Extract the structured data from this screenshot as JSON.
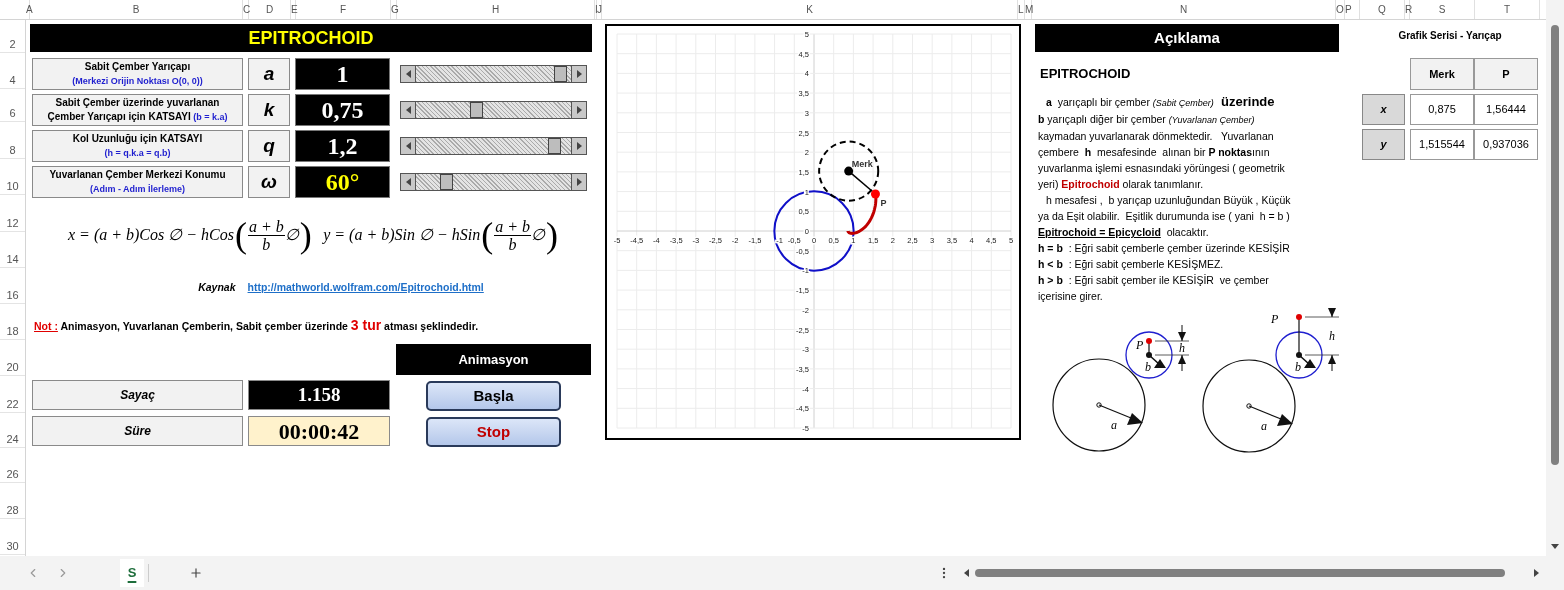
{
  "columns": [
    "A",
    "B",
    "C",
    "D",
    "E",
    "F",
    "G",
    "H",
    "I",
    "J",
    "K",
    "L",
    "M",
    "N",
    "O",
    "P",
    "Q",
    "R",
    "S",
    "T"
  ],
  "rows": [
    "2",
    "4",
    "6",
    "8",
    "10",
    "12",
    "14",
    "16",
    "18",
    "20",
    "22",
    "24",
    "26",
    "28",
    "30"
  ],
  "title": "EPITROCHOID",
  "parameters": [
    {
      "label": [
        "Sabit Çember Yarıçapı"
      ],
      "note": "(Merkezi Orijin Noktası O(0, 0))",
      "note_inline": false,
      "symbol": "a",
      "value": "1",
      "highlight": false,
      "level": 0.97
    },
    {
      "label": [
        "Sabit Çember üzerinde yuvarlanan",
        "Çember Yarıçapı için KATSAYI"
      ],
      "note": "(b = k.a)",
      "note_inline": true,
      "symbol": "k",
      "value": "0,75",
      "highlight": false,
      "level": 0.38
    },
    {
      "label": [
        "Kol Uzunluğu için KATSAYI"
      ],
      "note": "(h = q.k.a = q.b)",
      "note_inline": false,
      "symbol": "q",
      "value": "1,2",
      "highlight": false,
      "level": 0.93
    },
    {
      "label": [
        "Yuvarlanan Çember Merkezi Konumu"
      ],
      "note": "(Adım - Adım İlerleme)",
      "note_inline": false,
      "symbol": "ω",
      "value": "60°",
      "highlight": true,
      "level": 0.17
    }
  ],
  "formulas": [
    {
      "lhs": "x = (a + b)Cos ∅ − hCos",
      "open": "(",
      "num": "a + b",
      "den": "b",
      "tail": "∅",
      "close": ")"
    },
    {
      "lhs": "y = (a + b)Sin ∅ − hSin",
      "open": "(",
      "num": "a + b",
      "den": "b",
      "tail": "∅",
      "close": ")"
    }
  ],
  "source": {
    "label": "Kaynak",
    "url": "http://mathworld.wolfram.com/Epitrochoid.html"
  },
  "note": {
    "label": "Not :",
    "parts": [
      {
        "text": "Animasyon, Yuvarlanan Çemberin, Sabit çember üzerinde ",
        "kind": "plain"
      },
      {
        "text": "3 tur",
        "kind": "highlight"
      },
      {
        "text": " atması şeklindedir.",
        "kind": "plain"
      }
    ]
  },
  "counters": [
    {
      "label": "Sayaç",
      "value": "1.158",
      "kind": "dark"
    },
    {
      "label": "Süre",
      "value": "00:00:42",
      "kind": "light"
    }
  ],
  "animation": {
    "title": "Animasyon",
    "buttons": [
      {
        "label": "Başla",
        "kind": "start"
      },
      {
        "label": "Stop",
        "kind": "stop"
      }
    ]
  },
  "chart": {
    "chart_data": {
      "type": "scatter",
      "grid": true,
      "xlim": [
        -5,
        5
      ],
      "ylim": [
        -5,
        5
      ],
      "xticks": [
        {
          "value": -5,
          "label": "-5"
        },
        {
          "value": -4.5,
          "label": "-4,5"
        },
        {
          "value": -4,
          "label": "-4"
        },
        {
          "value": -3.5,
          "label": "-3,5"
        },
        {
          "value": -3,
          "label": "-3"
        },
        {
          "value": -2.5,
          "label": "-2,5"
        },
        {
          "value": -2,
          "label": "-2"
        },
        {
          "value": -1.5,
          "label": "-1,5"
        },
        {
          "value": -1,
          "label": "-1"
        },
        {
          "value": -0.5,
          "label": "-0,5"
        },
        {
          "value": 0,
          "label": "0"
        },
        {
          "value": 0.5,
          "label": "0,5"
        },
        {
          "value": 1,
          "label": "1"
        },
        {
          "value": 1.5,
          "label": "1,5"
        },
        {
          "value": 2,
          "label": "2"
        },
        {
          "value": 2.5,
          "label": "2,5"
        },
        {
          "value": 3,
          "label": "3"
        },
        {
          "value": 3.5,
          "label": "3,5"
        },
        {
          "value": 4,
          "label": "4"
        },
        {
          "value": 4.5,
          "label": "4,5"
        },
        {
          "value": 5,
          "label": "5"
        }
      ],
      "yticks": [
        {
          "value": -5,
          "label": "-5"
        },
        {
          "value": -4.5,
          "label": "-4,5"
        },
        {
          "value": -4,
          "label": "-4"
        },
        {
          "value": -3.5,
          "label": "-3,5"
        },
        {
          "value": -3,
          "label": "-3"
        },
        {
          "value": -2.5,
          "label": "-2,5"
        },
        {
          "value": -2,
          "label": "-2"
        },
        {
          "value": -1.5,
          "label": "-1,5"
        },
        {
          "value": -1,
          "label": "-1"
        },
        {
          "value": -0.5,
          "label": "-0,5"
        },
        {
          "value": 0,
          "label": "0"
        },
        {
          "value": 0.5,
          "label": "0,5"
        },
        {
          "value": 1,
          "label": "1"
        },
        {
          "value": 1.5,
          "label": "1,5"
        },
        {
          "value": 2,
          "label": "2"
        },
        {
          "value": 2.5,
          "label": "2,5"
        },
        {
          "value": 3,
          "label": "3"
        },
        {
          "value": 3.5,
          "label": "3,5"
        },
        {
          "value": 4,
          "label": "4"
        },
        {
          "value": 4.5,
          "label": "4,5"
        },
        {
          "value": 5,
          "label": "5"
        }
      ],
      "series": [
        {
          "name": "Merk",
          "color": "#000000",
          "x": [
            0.88
          ],
          "values": [
            1.52
          ]
        },
        {
          "name": "P",
          "color": "#ff0000",
          "x": [
            1.56
          ],
          "values": [
            0.94
          ]
        }
      ]
    }
  },
  "description": {
    "title": "Açıklama",
    "heading": "EPITROCHOID",
    "paragraphs": [
      {
        "indent": true,
        "lines": [
          [
            {
              "text": "a",
              "kind": "bold"
            },
            {
              "text": "  yarıçaplı bir çember ",
              "kind": "plain"
            },
            {
              "text": "(Sabit Çember)",
              "kind": "aside"
            },
            {
              "text": "  üzerinde",
              "kind": "emphasis"
            }
          ],
          [
            {
              "text": "b",
              "kind": "bold"
            },
            {
              "text": " yarıçaplı diğer bir çember ",
              "kind": "plain"
            },
            {
              "text": "(Yuvarlanan Çember)",
              "kind": "aside"
            }
          ],
          [
            {
              "text": "kaymadan yuvarlanarak dönmektedir.   Yuvarlanan",
              "kind": "plain"
            }
          ],
          [
            {
              "text": "çembere  ",
              "kind": "plain"
            },
            {
              "text": "h",
              "kind": "bold"
            },
            {
              "text": "  mesafesinde  alınan bir ",
              "kind": "plain"
            },
            {
              "text": "P noktas",
              "kind": "bold"
            },
            {
              "text": "ının",
              "kind": "plain"
            }
          ],
          [
            {
              "text": "yuvarlanma işlemi esnasındaki yörüngesi ( geometrik",
              "kind": "plain"
            }
          ],
          [
            {
              "text": "yeri) ",
              "kind": "plain"
            },
            {
              "text": "Epitrochoid",
              "kind": "term"
            },
            {
              "text": " olarak tanımlanır.",
              "kind": "plain"
            }
          ]
        ]
      },
      {
        "indent": true,
        "lines": [
          [
            {
              "text": "h mesafesi ,  b yarıçap uzunluğundan Büyük , Küçük",
              "kind": "plain"
            }
          ],
          [
            {
              "text": "ya da Eşit olabilir.  Eşitlik durumunda ise ( yani  h = b )",
              "kind": "plain"
            }
          ],
          [
            {
              "text": "Epitrochoid = Epicycloid",
              "kind": "underline"
            },
            {
              "text": "  olacaktır.",
              "kind": "plain"
            }
          ]
        ]
      },
      {
        "indent": false,
        "lines": [
          [
            {
              "text": "h = b",
              "kind": "bold"
            },
            {
              "text": "  : Eğri sabit çemberle çember üzerinde KESİŞİR",
              "kind": "plain"
            }
          ]
        ]
      },
      {
        "indent": false,
        "lines": [
          [
            {
              "text": "h < b",
              "kind": "bold"
            },
            {
              "text": "  : Eğri sabit çemberle KESİŞMEZ.",
              "kind": "plain"
            }
          ]
        ]
      },
      {
        "indent": false,
        "lines": [
          [
            {
              "text": "h > b",
              "kind": "bold"
            },
            {
              "text": "  : Eğri sabit çember ile KESİŞİR  ve çember",
              "kind": "plain"
            }
          ],
          [
            {
              "text": "içerisine girer.",
              "kind": "plain"
            }
          ]
        ]
      }
    ],
    "diagrams": [
      {
        "kind": "inside",
        "p": "P",
        "h": "h",
        "b": "b",
        "a": "a"
      },
      {
        "kind": "outside",
        "p": "P",
        "h": "h",
        "b": "b",
        "a": "a"
      }
    ]
  },
  "series_table": {
    "title": "Grafik Serisi - Yarıçap",
    "columns": [
      "Merk",
      "P"
    ],
    "rows": [
      {
        "label": "x",
        "cells": [
          "0,875",
          "1,56444"
        ]
      },
      {
        "label": "y",
        "cells": [
          "1,515544",
          "0,937036"
        ]
      }
    ]
  },
  "sheet_tabs": [
    {
      "label": "S",
      "selected": true
    }
  ]
}
